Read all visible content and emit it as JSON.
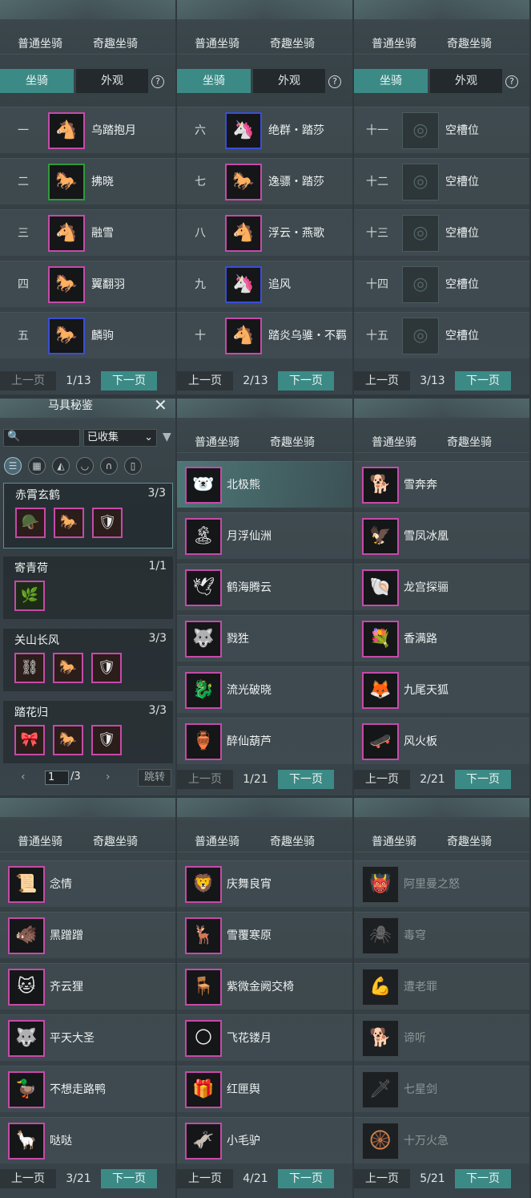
{
  "tabs": {
    "normal": "普通坐骑",
    "fun": "奇趣坐骑"
  },
  "subtabs": {
    "mount": "坐骑",
    "look": "外观",
    "help": "?"
  },
  "pager": {
    "prev": "上一页",
    "next": "下一页"
  },
  "panelA": [
    {
      "page": "1/13",
      "rows": [
        {
          "num": "一",
          "name": "乌踏抱月",
          "icon": "white-horse-icon",
          "glyph": "🐴",
          "frame": "pink"
        },
        {
          "num": "二",
          "name": "拂晓",
          "icon": "red-horse-icon",
          "glyph": "🐎",
          "frame": "green"
        },
        {
          "num": "三",
          "name": "融雪",
          "icon": "white-horse-icon",
          "glyph": "🐴",
          "frame": "pink"
        },
        {
          "num": "四",
          "name": "翼翻羽",
          "icon": "black-horse-icon",
          "glyph": "🐎",
          "frame": "pink"
        },
        {
          "num": "五",
          "name": "麟驹",
          "icon": "black-horse-icon",
          "glyph": "🐎",
          "frame": "blue"
        }
      ]
    },
    {
      "page": "2/13",
      "rows": [
        {
          "num": "六",
          "name": "绝群・踏莎",
          "icon": "unicorn-icon",
          "glyph": "🦄",
          "frame": "blue"
        },
        {
          "num": "七",
          "name": "逸骠・踏莎",
          "icon": "gold-horse-icon",
          "glyph": "🐎",
          "frame": "pink"
        },
        {
          "num": "八",
          "name": "浮云・燕歌",
          "icon": "white-horse-icon",
          "glyph": "🐴",
          "frame": "pink"
        },
        {
          "num": "九",
          "name": "追风",
          "icon": "unicorn-icon",
          "glyph": "🦄",
          "frame": "blue"
        },
        {
          "num": "十",
          "name": "踏炎乌骓・不羁",
          "icon": "white-horse-icon",
          "glyph": "🐴",
          "frame": "pink"
        }
      ]
    },
    {
      "page": "3/13",
      "rows": [
        {
          "num": "十一",
          "name": "空槽位",
          "icon": "empty-slot-icon",
          "glyph": "◎",
          "frame": "empty"
        },
        {
          "num": "十二",
          "name": "空槽位",
          "icon": "empty-slot-icon",
          "glyph": "◎",
          "frame": "empty"
        },
        {
          "num": "十三",
          "name": "空槽位",
          "icon": "empty-slot-icon",
          "glyph": "◎",
          "frame": "empty"
        },
        {
          "num": "十四",
          "name": "空槽位",
          "icon": "empty-slot-icon",
          "glyph": "◎",
          "frame": "empty"
        },
        {
          "num": "十五",
          "name": "空槽位",
          "icon": "empty-slot-icon",
          "glyph": "◎",
          "frame": "empty"
        }
      ]
    }
  ],
  "saddle": {
    "title": "马具秘鉴",
    "filter": "已收集",
    "page_current": "1",
    "page_total": "/3",
    "jump": "跳转",
    "sets": [
      {
        "name": "赤霄玄鹤",
        "count": "3/3",
        "pieces": [
          "🪖",
          "🐎",
          "🛡"
        ]
      },
      {
        "name": "寄青荷",
        "count": "1/1",
        "pieces": [
          "🌿"
        ]
      },
      {
        "name": "关山长风",
        "count": "3/3",
        "pieces": [
          "⛓",
          "🐎",
          "🛡"
        ]
      },
      {
        "name": "踏花归",
        "count": "3/3",
        "pieces": [
          "🎀",
          "🐎",
          "🛡"
        ]
      }
    ]
  },
  "panelB": [
    {
      "page": "1/21",
      "rows": [
        {
          "name": "北极熊",
          "icon": "polar-bear-icon",
          "glyph": "🐻‍❄️"
        },
        {
          "name": "月浮仙洲",
          "icon": "floating-island-icon",
          "glyph": "🏝"
        },
        {
          "name": "鹤海腾云",
          "icon": "crane-icon",
          "glyph": "🕊"
        },
        {
          "name": "戮狌",
          "icon": "beast-icon",
          "glyph": "🐺"
        },
        {
          "name": "流光破晓",
          "icon": "dragon-icon",
          "glyph": "🐉"
        },
        {
          "name": "醉仙葫芦",
          "icon": "gourd-icon",
          "glyph": "🏺"
        }
      ]
    },
    {
      "page": "2/21",
      "rows": [
        {
          "name": "雪奔奔",
          "icon": "snow-runner-icon",
          "glyph": "🐕"
        },
        {
          "name": "雪凤冰凰",
          "icon": "phoenix-icon",
          "glyph": "🦅"
        },
        {
          "name": "龙宫探骊",
          "icon": "shell-icon",
          "glyph": "🐚"
        },
        {
          "name": "香满路",
          "icon": "flower-cart-icon",
          "glyph": "💐"
        },
        {
          "name": "九尾天狐",
          "icon": "fox-icon",
          "glyph": "🦊"
        },
        {
          "name": "风火板",
          "icon": "skateboard-icon",
          "glyph": "🛹"
        }
      ]
    },
    {
      "page": "3/21",
      "rows": [
        {
          "name": "念情",
          "icon": "scroll-icon",
          "glyph": "📜"
        },
        {
          "name": "黑蹭蹭",
          "icon": "black-beast-icon",
          "glyph": "🐗"
        },
        {
          "name": "齐云狸",
          "icon": "cat-icon",
          "glyph": "🐱"
        },
        {
          "name": "平天大圣",
          "icon": "wolf-icon",
          "glyph": "🐺"
        },
        {
          "name": "不想走路鸭",
          "icon": "duck-icon",
          "glyph": "🦆"
        },
        {
          "name": "哒哒",
          "icon": "pink-horse-icon",
          "glyph": "🦙"
        }
      ]
    },
    {
      "page": "4/21",
      "rows": [
        {
          "name": "庆舞良宵",
          "icon": "lion-dance-icon",
          "glyph": "🦁"
        },
        {
          "name": "雪覆寒原",
          "icon": "white-deer-icon",
          "glyph": "🦌"
        },
        {
          "name": "紫微金阙交椅",
          "icon": "throne-icon",
          "glyph": "🪑"
        },
        {
          "name": "飞花镂月",
          "icon": "moon-orb-icon",
          "glyph": "🌕"
        },
        {
          "name": "红匣舆",
          "icon": "sedan-icon",
          "glyph": "🎁"
        },
        {
          "name": "小毛驴",
          "icon": "donkey-icon",
          "glyph": "🫏"
        }
      ]
    },
    {
      "page": "5/21",
      "rows": [
        {
          "name": "阿里曼之怒",
          "icon": "demon-icon",
          "glyph": "👹"
        },
        {
          "name": "毒穹",
          "icon": "spider-icon",
          "glyph": "🕷"
        },
        {
          "name": "遭老罪",
          "icon": "strongman-icon",
          "glyph": "💪"
        },
        {
          "name": "谛听",
          "icon": "hound-icon",
          "glyph": "🐕"
        },
        {
          "name": "七星剑",
          "icon": "sword-icon",
          "glyph": "🗡"
        },
        {
          "name": "十万火急",
          "icon": "fire-wheel-icon",
          "glyph": "🛞"
        }
      ]
    }
  ]
}
